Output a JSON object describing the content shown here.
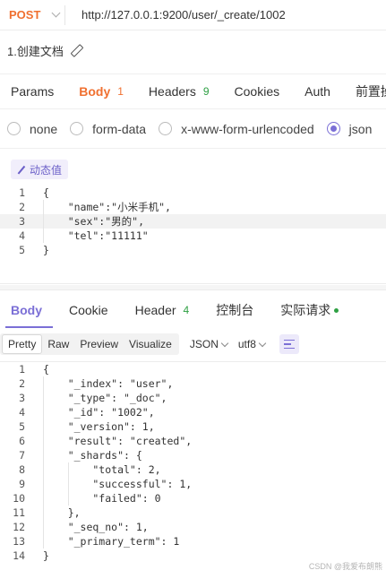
{
  "request": {
    "method": "POST",
    "url": "http://127.0.0.1:9200/user/_create/1002",
    "doc_title": "1.创建文档"
  },
  "req_tabs": [
    {
      "label": "Params",
      "badge": ""
    },
    {
      "label": "Body",
      "badge": "1"
    },
    {
      "label": "Headers",
      "badge": "9"
    },
    {
      "label": "Cookies",
      "badge": ""
    },
    {
      "label": "Auth",
      "badge": ""
    },
    {
      "label": "前置操",
      "badge": ""
    }
  ],
  "body_types": [
    {
      "label": "none",
      "checked": false
    },
    {
      "label": "form-data",
      "checked": false
    },
    {
      "label": "x-www-form-urlencoded",
      "checked": false
    },
    {
      "label": "json",
      "checked": true
    }
  ],
  "dynamic_value_label": "动态值",
  "request_body_lines": [
    {
      "n": "1",
      "text": "{"
    },
    {
      "n": "2",
      "text": "    \"name\":\"小米手机\","
    },
    {
      "n": "3",
      "text": "    \"sex\":\"男的\","
    },
    {
      "n": "4",
      "text": "    \"tel\":\"11111\""
    },
    {
      "n": "5",
      "text": "}"
    }
  ],
  "resp_tabs": [
    {
      "label": "Body",
      "badge": ""
    },
    {
      "label": "Cookie",
      "badge": ""
    },
    {
      "label": "Header",
      "badge": "4"
    },
    {
      "label": "控制台",
      "badge": ""
    },
    {
      "label": "实际请求",
      "badge": ""
    }
  ],
  "view_modes": [
    "Pretty",
    "Raw",
    "Preview",
    "Visualize"
  ],
  "format_select": "JSON",
  "encoding_select": "utf8",
  "response_lines": [
    {
      "n": "1",
      "text": "{"
    },
    {
      "n": "2",
      "text": "    \"_index\": \"user\","
    },
    {
      "n": "3",
      "text": "    \"_type\": \"_doc\","
    },
    {
      "n": "4",
      "text": "    \"_id\": \"1002\","
    },
    {
      "n": "5",
      "text": "    \"_version\": 1,"
    },
    {
      "n": "6",
      "text": "    \"result\": \"created\","
    },
    {
      "n": "7",
      "text": "    \"_shards\": {"
    },
    {
      "n": "8",
      "text": "        \"total\": 2,"
    },
    {
      "n": "9",
      "text": "        \"successful\": 1,"
    },
    {
      "n": "10",
      "text": "        \"failed\": 0"
    },
    {
      "n": "11",
      "text": "    },"
    },
    {
      "n": "12",
      "text": "    \"_seq_no\": 1,"
    },
    {
      "n": "13",
      "text": "    \"_primary_term\": 1"
    },
    {
      "n": "14",
      "text": "}"
    }
  ],
  "watermark": "CSDN @我爱布朗熊",
  "colors": {
    "method": "#f07030",
    "accent": "#7b6fd6",
    "badge_green": "#2ea043"
  }
}
